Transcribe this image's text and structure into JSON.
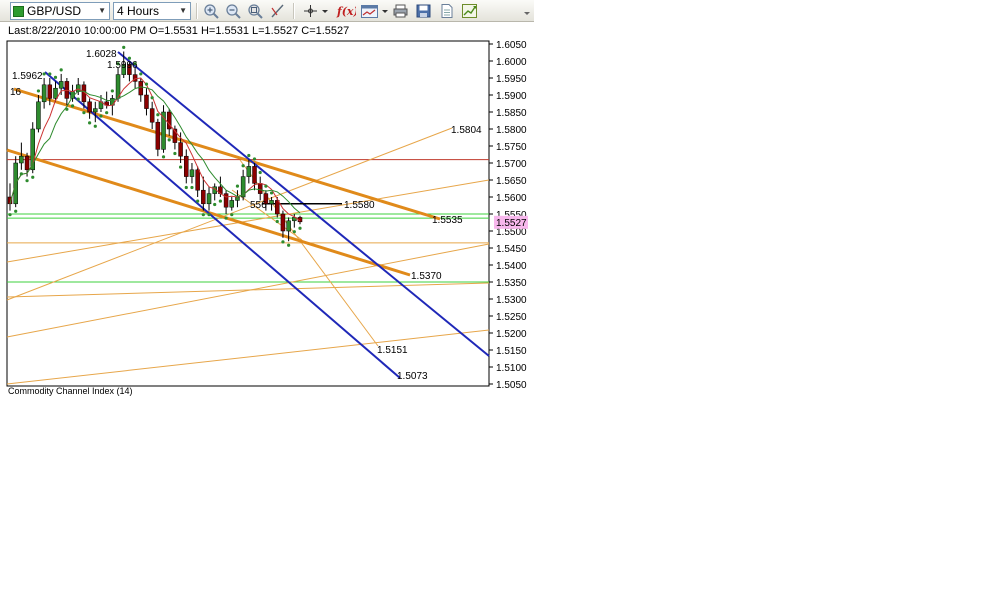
{
  "toolbar": {
    "symbol": "GBP/USD",
    "timeframe": "4 Hours",
    "icons": [
      "zoom-in-icon",
      "zoom-out-icon",
      "zoom-fit-icon",
      "draw-line-icon",
      "crosshair-icon",
      "function-icon",
      "chart-style-icon",
      "print-icon",
      "save-icon",
      "page-icon",
      "export-icon",
      "more-icon"
    ]
  },
  "info": {
    "text": "Last:8/22/2010 10:00:00 PM O=1.5531 H=1.5531 L=1.5527 C=1.5527"
  },
  "colors": {
    "channel": "#1f28b8",
    "fib": "#e08a1a",
    "fib_thin": "#e7a64a",
    "resistance": "#c0392b",
    "support": "#3cd03c",
    "sar": "#2e8b2e",
    "ma": "#cc3333",
    "bull": "#2e8b2e",
    "bear": "#8b0000",
    "price_tag": "#f7b7ec"
  },
  "chart_data": {
    "type": "candlestick",
    "symbol": "GBP/USD",
    "interval": "4 Hours",
    "ylim": [
      1.505,
      1.605
    ],
    "yticks": [
      "1.6050",
      "1.6000",
      "1.5950",
      "1.5900",
      "1.5850",
      "1.5800",
      "1.5750",
      "1.5700",
      "1.5650",
      "1.5600",
      "1.5550",
      "1.5500",
      "1.5450",
      "1.5400",
      "1.5350",
      "1.5300",
      "1.5250",
      "1.5200",
      "1.5150",
      "1.5100",
      "1.5050"
    ],
    "last_price": "1.5527",
    "candles": [
      [
        1.56,
        1.564,
        1.556,
        1.558
      ],
      [
        1.558,
        1.572,
        1.557,
        1.57
      ],
      [
        1.57,
        1.576,
        1.568,
        1.572
      ],
      [
        1.572,
        1.573,
        1.566,
        1.568
      ],
      [
        1.568,
        1.582,
        1.567,
        1.58
      ],
      [
        1.58,
        1.59,
        1.579,
        1.588
      ],
      [
        1.588,
        1.595,
        1.586,
        1.593
      ],
      [
        1.593,
        1.595,
        1.587,
        1.589
      ],
      [
        1.589,
        1.594,
        1.588,
        1.592
      ],
      [
        1.592,
        1.5962,
        1.59,
        1.594
      ],
      [
        1.594,
        1.595,
        1.587,
        1.589
      ],
      [
        1.589,
        1.593,
        1.588,
        1.591
      ],
      [
        1.591,
        1.595,
        1.59,
        1.593
      ],
      [
        1.593,
        1.594,
        1.586,
        1.588
      ],
      [
        1.588,
        1.589,
        1.583,
        1.585
      ],
      [
        1.585,
        1.588,
        1.582,
        1.586
      ],
      [
        1.586,
        1.59,
        1.585,
        1.588
      ],
      [
        1.588,
        1.591,
        1.586,
        1.587
      ],
      [
        1.587,
        1.59,
        1.584,
        1.589
      ],
      [
        1.589,
        1.598,
        1.588,
        1.596
      ],
      [
        1.596,
        1.6028,
        1.595,
        1.599
      ],
      [
        1.599,
        1.5996,
        1.594,
        1.596
      ],
      [
        1.596,
        1.598,
        1.592,
        1.594
      ],
      [
        1.594,
        1.595,
        1.588,
        1.59
      ],
      [
        1.59,
        1.592,
        1.584,
        1.586
      ],
      [
        1.586,
        1.588,
        1.58,
        1.582
      ],
      [
        1.582,
        1.583,
        1.572,
        1.574
      ],
      [
        1.574,
        1.587,
        1.573,
        1.585
      ],
      [
        1.585,
        1.586,
        1.578,
        1.58
      ],
      [
        1.58,
        1.581,
        1.574,
        1.576
      ],
      [
        1.576,
        1.579,
        1.57,
        1.572
      ],
      [
        1.572,
        1.574,
        1.564,
        1.566
      ],
      [
        1.566,
        1.57,
        1.564,
        1.568
      ],
      [
        1.568,
        1.569,
        1.56,
        1.562
      ],
      [
        1.562,
        1.566,
        1.556,
        1.558
      ],
      [
        1.558,
        1.563,
        1.556,
        1.561
      ],
      [
        1.561,
        1.564,
        1.559,
        1.563
      ],
      [
        1.563,
        1.566,
        1.56,
        1.561
      ],
      [
        1.561,
        1.562,
        1.555,
        1.557
      ],
      [
        1.557,
        1.56,
        1.556,
        1.559
      ],
      [
        1.559,
        1.562,
        1.557,
        1.56
      ],
      [
        1.56,
        1.568,
        1.559,
        1.566
      ],
      [
        1.566,
        1.571,
        1.564,
        1.569
      ],
      [
        1.569,
        1.57,
        1.562,
        1.564
      ],
      [
        1.564,
        1.566,
        1.559,
        1.561
      ],
      [
        1.561,
        1.562,
        1.556,
        1.558
      ],
      [
        1.558,
        1.56,
        1.556,
        1.559
      ],
      [
        1.559,
        1.56,
        1.554,
        1.555
      ],
      [
        1.555,
        1.556,
        1.548,
        1.55
      ],
      [
        1.55,
        1.554,
        1.547,
        1.553
      ],
      [
        1.553,
        1.555,
        1.551,
        1.554
      ],
      [
        1.554,
        1.5545,
        1.552,
        1.5527
      ]
    ],
    "annotations": [
      {
        "text": "1.6028",
        "price": 1.6028
      },
      {
        "text": "1.5996",
        "price": 1.5996
      },
      {
        "text": "1.5962",
        "price": 1.5962
      },
      {
        "text": "16",
        "price": 1.5912
      },
      {
        "text": "1.5804",
        "price": 1.5804
      },
      {
        "text": "1.5580",
        "price": 1.558
      },
      {
        "text": "556",
        "price": 1.558
      },
      {
        "text": "1.5535",
        "price": 1.5535
      },
      {
        "text": "1.5370",
        "price": 1.537
      },
      {
        "text": "1.5151",
        "price": 1.5151
      },
      {
        "text": "1.5073",
        "price": 1.5073
      }
    ],
    "horizontal_lines": [
      {
        "price": 1.571,
        "role": "resistance"
      },
      {
        "price": 1.555,
        "role": "support"
      },
      {
        "price": 1.5538,
        "role": "support"
      },
      {
        "price": 1.5465,
        "role": "fib_thin"
      },
      {
        "price": 1.535,
        "role": "support"
      }
    ]
  },
  "indicator": {
    "label": "Commodity Channel Index (14)"
  }
}
